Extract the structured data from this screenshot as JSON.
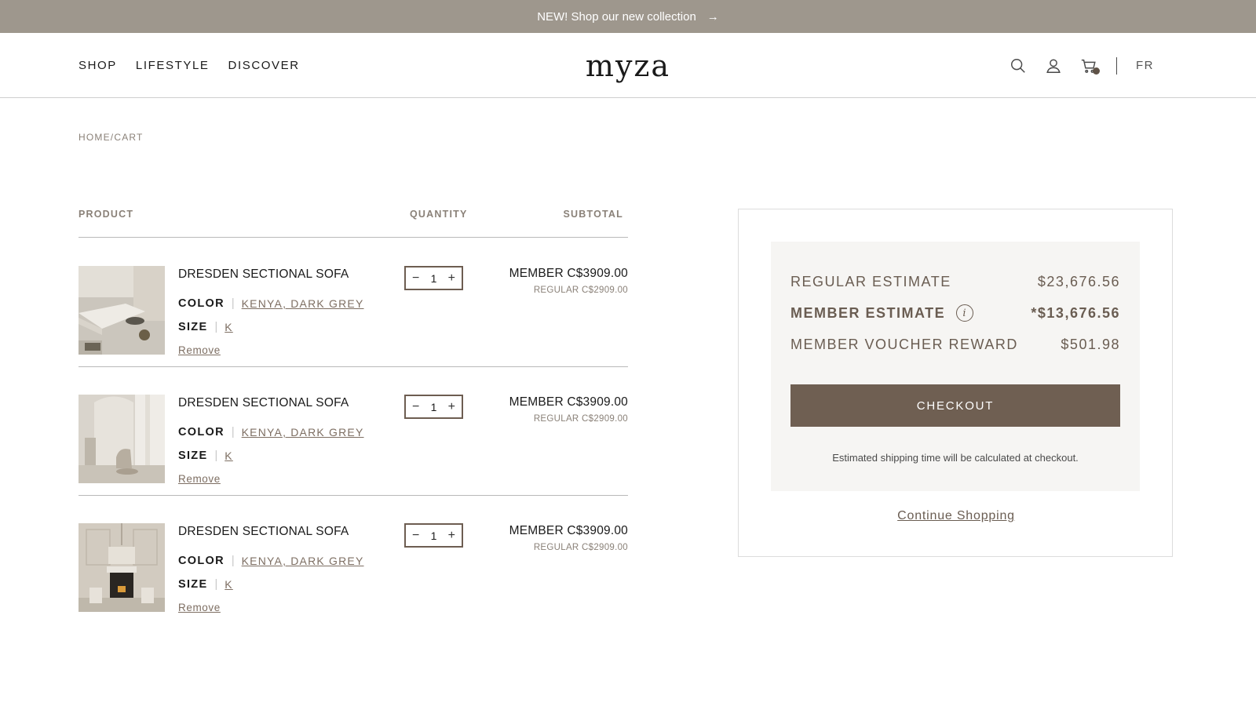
{
  "announcement": {
    "text": "NEW! Shop our new collection",
    "arrow": "→"
  },
  "header": {
    "nav": [
      "SHOP",
      "LIFESTYLE",
      "DISCOVER"
    ],
    "logo": "myza",
    "icons": [
      "search-icon",
      "account-icon",
      "cart-icon"
    ],
    "language": "FR"
  },
  "breadcrumb": "HOME/CART",
  "table": {
    "headers": {
      "product": "PRODUCT",
      "quantity": "QUANTITY",
      "subtotal": "SUBTOTAL"
    },
    "items": [
      {
        "name": "DRESDEN SECTIONAL SOFA",
        "color_label": "COLOR",
        "color_value": "KENYA, DARK GREY",
        "size_label": "SIZE",
        "size_value": "K",
        "remove": "Remove",
        "quantity": "1",
        "member_price": "MEMBER C$3909.00",
        "regular_price": "REGULAR C$2909.00"
      },
      {
        "name": "DRESDEN SECTIONAL SOFA",
        "color_label": "COLOR",
        "color_value": "KENYA, DARK GREY",
        "size_label": "SIZE",
        "size_value": "K",
        "remove": "Remove",
        "quantity": "1",
        "member_price": "MEMBER C$3909.00",
        "regular_price": "REGULAR C$2909.00"
      },
      {
        "name": "DRESDEN SECTIONAL SOFA",
        "color_label": "COLOR",
        "color_value": "KENYA, DARK GREY",
        "size_label": "SIZE",
        "size_value": "K",
        "remove": "Remove",
        "quantity": "1",
        "member_price": "MEMBER C$3909.00",
        "regular_price": "REGULAR C$2909.00"
      }
    ]
  },
  "summary": {
    "regular_label": "REGULAR ESTIMATE",
    "regular_value": "$23,676.56",
    "member_label": "MEMBER ESTIMATE",
    "member_value": "*$13,676.56",
    "voucher_label": "MEMBER VOUCHER REWARD",
    "voucher_value": "$501.98",
    "checkout": "CHECKOUT",
    "shipping_note": "Estimated shipping time will be calculated at checkout.",
    "continue": "Continue Shopping"
  },
  "colors": {
    "announcement_bg": "#9e978d",
    "accent": "#6f5f52",
    "panel_bg": "#f6f5f3",
    "link": "#7d6e62"
  }
}
